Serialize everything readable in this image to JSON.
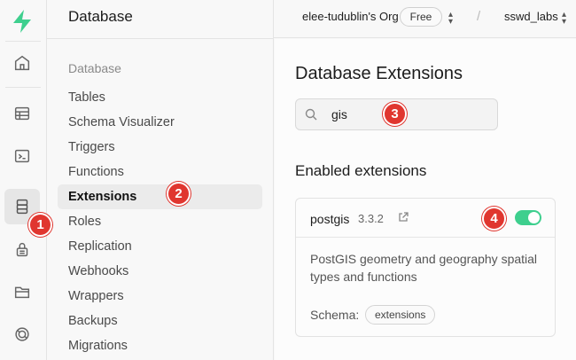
{
  "colors": {
    "brand": "#3ecf8e",
    "annotation": "#e0362f"
  },
  "rail": {
    "icons": [
      "home-icon",
      "table-editor-icon",
      "sql-editor-icon",
      "database-icon",
      "auth-lock-icon",
      "storage-icon",
      "realtime-icon"
    ]
  },
  "menu": {
    "title": "Database",
    "section": "Database",
    "items": [
      {
        "label": "Tables"
      },
      {
        "label": "Schema Visualizer"
      },
      {
        "label": "Triggers"
      },
      {
        "label": "Functions"
      },
      {
        "label": "Extensions",
        "active": true
      },
      {
        "label": "Roles"
      },
      {
        "label": "Replication"
      },
      {
        "label": "Webhooks"
      },
      {
        "label": "Wrappers"
      },
      {
        "label": "Backups"
      },
      {
        "label": "Migrations"
      }
    ]
  },
  "topbar": {
    "org": "elee-tudublin's Org",
    "plan": "Free",
    "separator": "/",
    "project": "sswd_labs"
  },
  "main": {
    "title": "Database Extensions",
    "search_value": "gis",
    "enabled_title": "Enabled extensions",
    "extension": {
      "name": "postgis",
      "version": "3.3.2",
      "enabled": true,
      "description": "PostGIS geometry and geography spatial types and functions",
      "schema_label": "Schema:",
      "schema_value": "extensions"
    }
  },
  "annotations": [
    "1",
    "2",
    "3",
    "4"
  ]
}
